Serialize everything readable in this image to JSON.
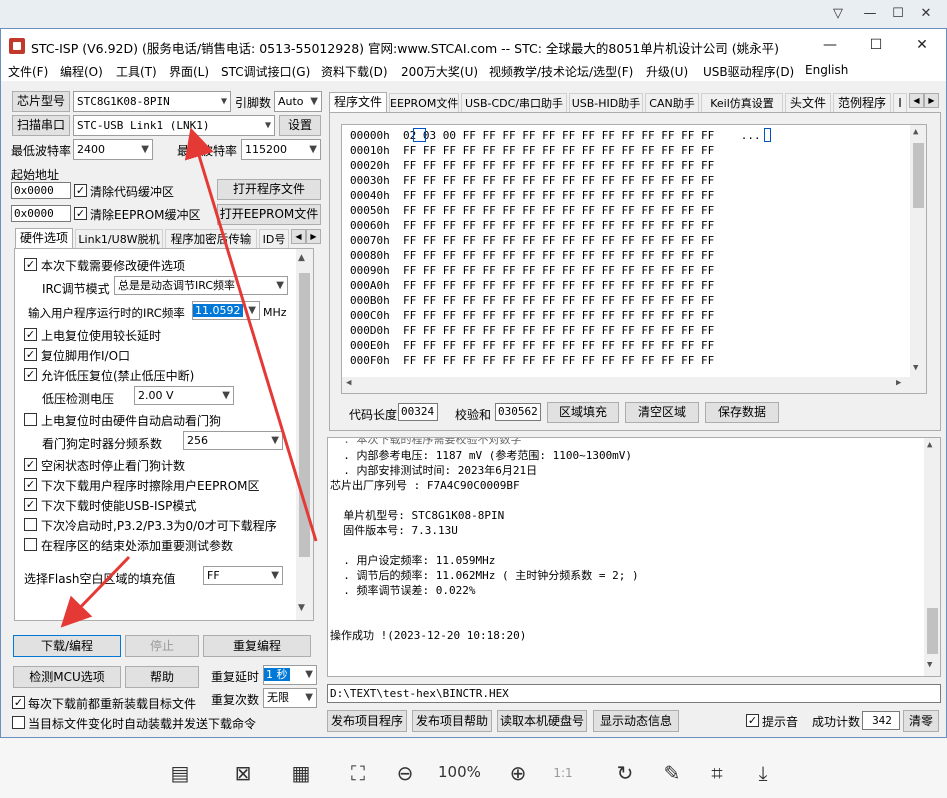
{
  "viewer": {
    "min": "—",
    "max": "☐",
    "close": "✕",
    "more": "▽"
  },
  "app": {
    "title": "STC-ISP (V6.92D) (服务电话/销售电话: 0513-55012928) 官网:www.STCAI.com  -- STC: 全球最大的8051单片机设计公司 (姚永平)",
    "win_min": "—",
    "win_max": "☐",
    "win_close": "✕"
  },
  "menu": [
    "文件(F)",
    "编程(O)",
    "工具(T)",
    "界面(L)",
    "STC调试接口(G)",
    "资料下载(D)",
    "200万大奖(U)",
    "视频教学/技术论坛/选型(F)",
    "升级(U)",
    "USB驱动程序(D)",
    "English"
  ],
  "left": {
    "chip_btn": "芯片型号",
    "chip_value": "STC8G1K08-8PIN",
    "pin_label": "引脚数",
    "pin_value": "Auto",
    "scan_btn": "扫描串口",
    "port_value": "STC-USB Link1 (LNK1)",
    "settings_btn": "设置",
    "min_baud_label": "最低波特率",
    "min_baud": "2400",
    "max_baud_label": "最高波特率",
    "max_baud": "115200",
    "start_addr_label": "起始地址",
    "addr1": "0x0000",
    "clear_code_label": "清除代码缓冲区",
    "open_prog_btn": "打开程序文件",
    "addr2": "0x0000",
    "clear_eeprom_label": "清除EEPROM缓冲区",
    "open_eeprom_btn": "打开EEPROM文件",
    "tabs": [
      "硬件选项",
      "Link1/U8W脱机",
      "程序加密后传输",
      "ID号"
    ],
    "opt_modify": "本次下载需要修改硬件选项",
    "irc_label": "IRC调节模式",
    "irc_value": "总是是动态调节IRC频率",
    "freq_label": "输入用户程序运行时的IRC频率",
    "freq_value": "11.0592",
    "freq_unit": "MHz",
    "opt_delay": "上电复位使用较长延时",
    "opt_reset_io": "复位脚用作I/O口",
    "opt_lvr": "允许低压复位(禁止低压中断)",
    "lvd_label": "低压检测电压",
    "lvd_value": "2.00 V",
    "opt_wdt": "上电复位时由硬件自动启动看门狗",
    "wdt_div_label": "看门狗定时器分频系数",
    "wdt_div_value": "256",
    "opt_idle_wdt": "空闲状态时停止看门狗计数",
    "opt_erase_eeprom": "下次下载用户程序时擦除用户EEPROM区",
    "opt_usb_isp": "下次下载时使能USB-ISP模式",
    "opt_p32": "下次冷启动时,P3.2/P3.3为0/0才可下载程序",
    "opt_test_param": "在程序区的结束处添加重要测试参数",
    "fill_label": "选择Flash空白区域的填充值",
    "fill_value": "FF",
    "download_btn": "下载/编程",
    "stop_btn": "停止",
    "reprog_btn": "重复编程",
    "check_mcu_btn": "检测MCU选项",
    "help_btn": "帮助",
    "repeat_delay_label": "重复延时",
    "repeat_delay_value": "1 秒",
    "repeat_count_label": "重复次数",
    "repeat_count_value": "无限",
    "reload_label": "每次下载前都重新装载目标文件",
    "auto_send_label": "当目标文件变化时自动装载并发送下载命令"
  },
  "right": {
    "tabs": [
      "程序文件",
      "EEPROM文件",
      "USB-CDC/串口助手",
      "USB-HID助手",
      "CAN助手",
      "Keil仿真设置",
      "头文件",
      "范例程序",
      "I"
    ],
    "hex_rows": [
      {
        "addr": "00000h",
        "bytes": "02 03 00 FF FF FF FF FF FF FF FF FF FF FF FF FF",
        "ascii": "..."
      },
      {
        "addr": "00010h",
        "bytes": "FF FF FF FF FF FF FF FF FF FF FF FF FF FF FF FF",
        "ascii": ""
      },
      {
        "addr": "00020h",
        "bytes": "FF FF FF FF FF FF FF FF FF FF FF FF FF FF FF FF",
        "ascii": ""
      },
      {
        "addr": "00030h",
        "bytes": "FF FF FF FF FF FF FF FF FF FF FF FF FF FF FF FF",
        "ascii": ""
      },
      {
        "addr": "00040h",
        "bytes": "FF FF FF FF FF FF FF FF FF FF FF FF FF FF FF FF",
        "ascii": ""
      },
      {
        "addr": "00050h",
        "bytes": "FF FF FF FF FF FF FF FF FF FF FF FF FF FF FF FF",
        "ascii": ""
      },
      {
        "addr": "00060h",
        "bytes": "FF FF FF FF FF FF FF FF FF FF FF FF FF FF FF FF",
        "ascii": ""
      },
      {
        "addr": "00070h",
        "bytes": "FF FF FF FF FF FF FF FF FF FF FF FF FF FF FF FF",
        "ascii": ""
      },
      {
        "addr": "00080h",
        "bytes": "FF FF FF FF FF FF FF FF FF FF FF FF FF FF FF FF",
        "ascii": ""
      },
      {
        "addr": "00090h",
        "bytes": "FF FF FF FF FF FF FF FF FF FF FF FF FF FF FF FF",
        "ascii": ""
      },
      {
        "addr": "000A0h",
        "bytes": "FF FF FF FF FF FF FF FF FF FF FF FF FF FF FF FF",
        "ascii": ""
      },
      {
        "addr": "000B0h",
        "bytes": "FF FF FF FF FF FF FF FF FF FF FF FF FF FF FF FF",
        "ascii": ""
      },
      {
        "addr": "000C0h",
        "bytes": "FF FF FF FF FF FF FF FF FF FF FF FF FF FF FF FF",
        "ascii": ""
      },
      {
        "addr": "000D0h",
        "bytes": "FF FF FF FF FF FF FF FF FF FF FF FF FF FF FF FF",
        "ascii": ""
      },
      {
        "addr": "000E0h",
        "bytes": "FF FF FF FF FF FF FF FF FF FF FF FF FF FF FF FF",
        "ascii": ""
      },
      {
        "addr": "000F0h",
        "bytes": "FF FF FF FF FF FF FF FF FF FF FF FF FF FF FF FF",
        "ascii": ""
      }
    ],
    "code_len_label": "代码长度",
    "code_len": "00324",
    "checksum_label": "校验和",
    "checksum": "030562",
    "fill_btn": "区域填充",
    "clear_btn": "清空区域",
    "save_btn": "保存数据",
    "log_partial": "  . 本次下载的程序需要校验不对数字",
    "log_lines": [
      "  . 内部参考电压: 1187 mV (参考范围: 1100~1300mV)",
      "  . 内部安排测试时间: 2023年6月21日",
      "芯片出厂序列号 : F7A4C90C0009BF",
      "",
      "  单片机型号: STC8G1K08-8PIN",
      "  固件版本号: 7.3.13U",
      "",
      "  . 用户设定频率: 11.059MHz",
      "  . 调节后的频率: 11.062MHz ( 主时钟分频系数 = 2; )",
      "  . 频率调节误差: 0.022%",
      "",
      "",
      "操作成功 !(2023-12-20 10:18:20)"
    ],
    "file_path": "D:\\TEXT\\test-hex\\BINCTR.HEX",
    "publish_btn": "发布项目程序",
    "publish_help_btn": "发布项目帮助",
    "read_disk_btn": "读取本机硬盘号",
    "dynamic_btn": "显示动态信息",
    "beep_label": "提示音",
    "success_label": "成功计数",
    "success_count": "342",
    "clear_count_btn": "清零"
  },
  "bottom": {
    "zoom": "100%"
  },
  "annotation_color": "#e53935"
}
